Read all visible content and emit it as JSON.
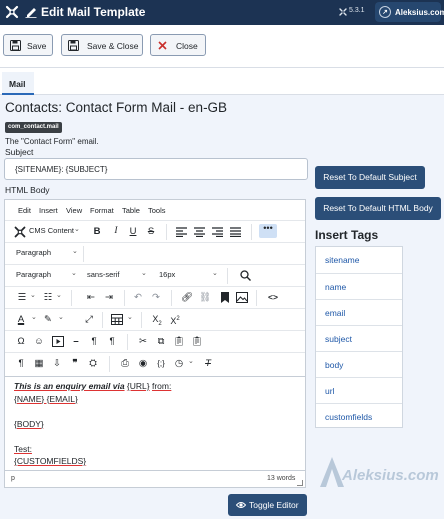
{
  "header": {
    "title": "Edit Mail Template",
    "version": "5.3.1",
    "site_button": "Aleksius.com"
  },
  "toolbar": {
    "save": "Save",
    "save_close": "Save & Close",
    "close": "Close"
  },
  "tabs": [
    {
      "label": "Mail",
      "active": true
    }
  ],
  "page": {
    "title": "Contacts: Contact Form Mail - en-GB",
    "key_badge": "com_contact.mail",
    "description": "The \"Contact Form\" email.",
    "subject_label": "Subject",
    "subject_value": "{SITENAME}: {SUBJECT}",
    "body_label": "HTML Body"
  },
  "editor": {
    "menu": [
      "Edit",
      "Insert",
      "View",
      "Format",
      "Table",
      "Tools"
    ],
    "cms_content": "CMS Content",
    "block_format_1": "Paragraph",
    "block_format_2": "Paragraph",
    "font_family": "sans-serif",
    "font_size": "16px",
    "content": {
      "line1_em": "This is an enquiry email via",
      "line1_url": "{URL}",
      "line1_end": "from:",
      "line2": "{NAME} {EMAIL}",
      "line3": "{BODY}",
      "line4": "Test:",
      "line5": "{CUSTOMFIELDS}"
    },
    "status_path": "p",
    "word_count": "13 words"
  },
  "side": {
    "reset_subject": "Reset To Default Subject",
    "reset_html": "Reset To Default HTML Body",
    "insert_tags_title": "Insert Tags",
    "tags": [
      "sitename",
      "name",
      "email",
      "subject",
      "body",
      "url",
      "customfields"
    ]
  },
  "toggle_editor": "Toggle Editor",
  "watermark": "Aleksius.com",
  "colors": {
    "header_bg": "#1c3353",
    "primary_button": "#2b4e78",
    "link": "#1f58a8",
    "close_x": "#c9302c"
  }
}
